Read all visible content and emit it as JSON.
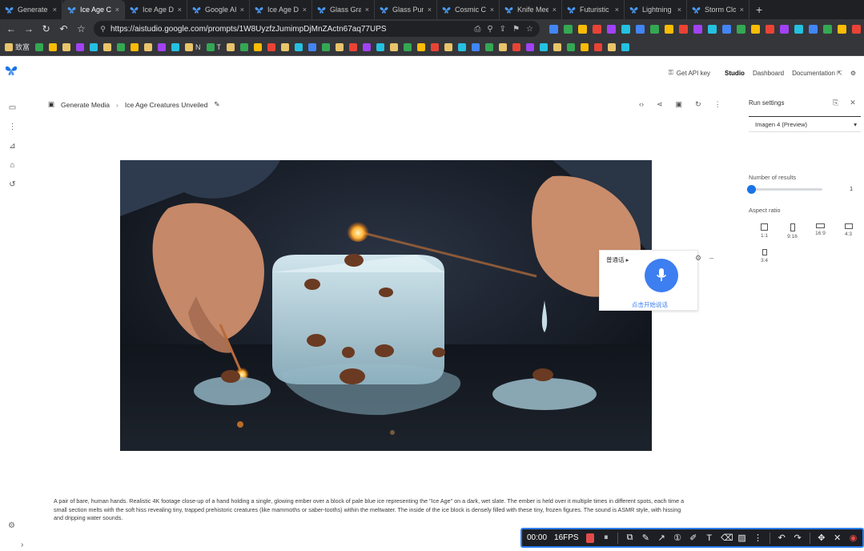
{
  "browser": {
    "tabs": [
      {
        "title": "Generate M",
        "active": false
      },
      {
        "title": "Ice Age Cre",
        "active": true
      },
      {
        "title": "Ice Age Disc",
        "active": false
      },
      {
        "title": "Google AI St",
        "active": false
      },
      {
        "title": "Ice Age Disc",
        "active": false
      },
      {
        "title": "Glass Grape",
        "active": false
      },
      {
        "title": "Glass Pumpk",
        "active": false
      },
      {
        "title": "Cosmic Cub",
        "active": false
      },
      {
        "title": "Knife Meets",
        "active": false
      },
      {
        "title": "Futuristic N",
        "active": false
      },
      {
        "title": "Lightning C",
        "active": false
      },
      {
        "title": "Storm Cloud",
        "active": false
      }
    ],
    "url": "https://aistudio.google.com/prompts/1W8UyzfzJumimpDjMnZActn67aq77UPS",
    "bookmarks": [
      "致富",
      "",
      "",
      "",
      "",
      "",
      "",
      "",
      "",
      "",
      "",
      "",
      "N",
      "T"
    ],
    "accent_colors": [
      "#4285f4",
      "#34a853",
      "#fbbc05",
      "#ea4335",
      "#a142f4",
      "#24c1e0"
    ]
  },
  "app": {
    "topnav": {
      "api_key": "Get API key",
      "studio": "Studio",
      "dashboard": "Dashboard",
      "documentation": "Documentation"
    },
    "breadcrumb": {
      "parent": "Generate Media",
      "current": "Ice Age Creatures Unveiled"
    },
    "caption": "A pair of bare, human hands. Realistic 4K footage close-up of a hand holding a single, glowing ember over a block of pale blue ice representing the \"Ice Age\" on a dark, wet slate. The ember is held over it multiple times in different spots, each time a small section melts with the soft hiss revealing tiny, trapped prehistoric creatures (like mammoths or saber-tooths) within the meltwater. The inside of the ice block is densely filled with these tiny, frozen figures. The sound is ASMR style, with hissing and dripping water sounds.",
    "run_settings": {
      "title": "Run settings",
      "model": "Imagen 4 (Preview)",
      "num_results_label": "Number of results",
      "num_results_value": "1",
      "num_results_fraction": 0.0,
      "aspect_ratio_label": "Aspect ratio",
      "ratios": [
        "1:1",
        "9:16",
        "16:9",
        "4:3",
        "3:4"
      ]
    },
    "voice_widget": {
      "lang": "普通话",
      "hint": "点击开始说话"
    }
  },
  "recorder": {
    "time": "00:00",
    "fps": "16FPS"
  }
}
